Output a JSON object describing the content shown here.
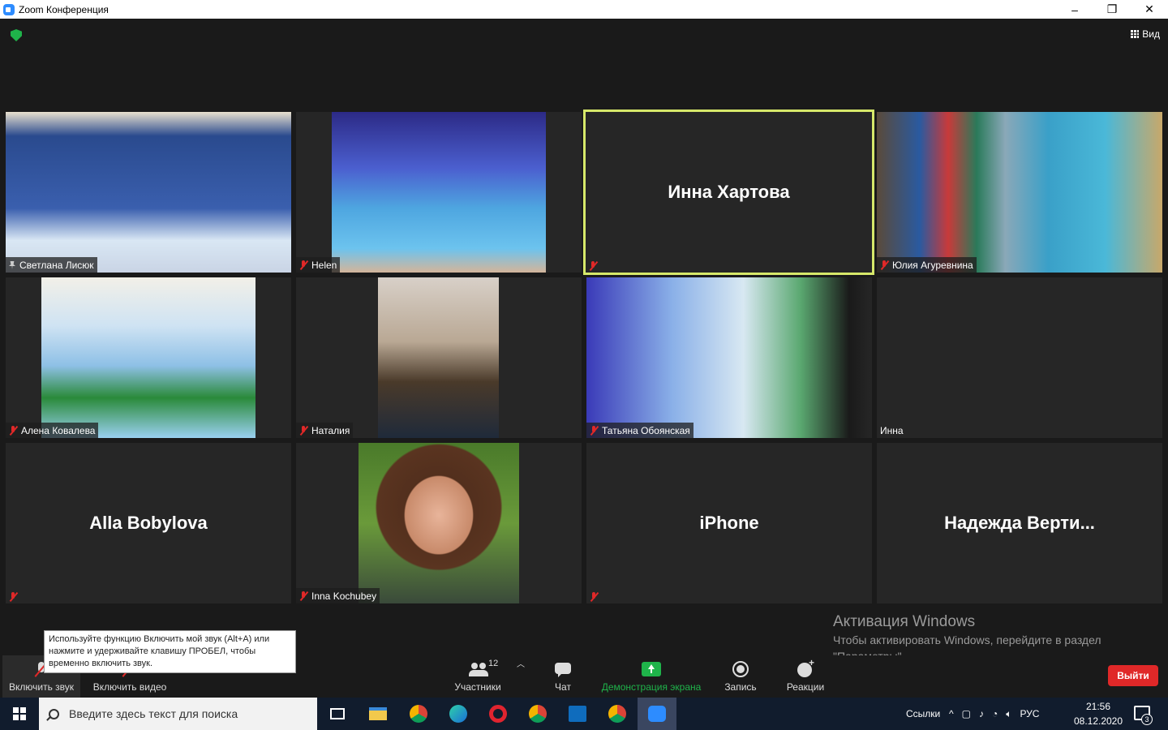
{
  "window": {
    "title": "Zoom Конференция",
    "minimize": "–",
    "maximize": "❐",
    "close": "✕"
  },
  "header": {
    "view_label": "Вид"
  },
  "tiles": [
    {
      "name": "Светлана Лисюк",
      "type": "video",
      "pinned": true
    },
    {
      "name": "Helen",
      "type": "video",
      "muted": true
    },
    {
      "name": "Инна Хартова",
      "type": "name",
      "muted": true,
      "active_speaker": true
    },
    {
      "name": "Юлия Агуревнина",
      "type": "video",
      "muted": true
    },
    {
      "name": "Алена Ковалева",
      "type": "video",
      "muted": true
    },
    {
      "name": "Наталия",
      "type": "video",
      "muted": true
    },
    {
      "name": "Татьяна Обоянская",
      "type": "video",
      "muted": true
    },
    {
      "name": "Инна",
      "type": "empty"
    },
    {
      "name": "Alla Bobylova",
      "type": "name",
      "muted": true
    },
    {
      "name": "Inna Kochubey",
      "type": "photo",
      "muted": true
    },
    {
      "name": "iPhone",
      "type": "name",
      "muted": true
    },
    {
      "name": "Надежда  Верти...",
      "type": "name"
    }
  ],
  "tooltip": {
    "text": "Используйте функцию Включить мой звук (Alt+A) или нажмите и удерживайте клавишу ПРОБЕЛ, чтобы временно включить звук."
  },
  "toolbar": {
    "unmute": "Включить звук",
    "start_video": "Включить видео",
    "participants": "Участники",
    "participants_count": "12",
    "chat": "Чат",
    "share_screen": "Демонстрация экрана",
    "record": "Запись",
    "reactions": "Реакции",
    "leave": "Выйти"
  },
  "watermark": {
    "title": "Активация Windows",
    "line1": "Чтобы активировать Windows, перейдите в раздел",
    "line2": "\"Параметры\"."
  },
  "taskbar": {
    "search_placeholder": "Введите здесь текст для поиска",
    "links_label": "Ссылки",
    "lang": "РУС",
    "time": "21:56",
    "date": "08.12.2020",
    "notifications": "3"
  },
  "colors": {
    "active_border": "#d6e86a",
    "share_green": "#1fb34a",
    "leave_red": "#e02828",
    "mute_red": "#e02828"
  }
}
